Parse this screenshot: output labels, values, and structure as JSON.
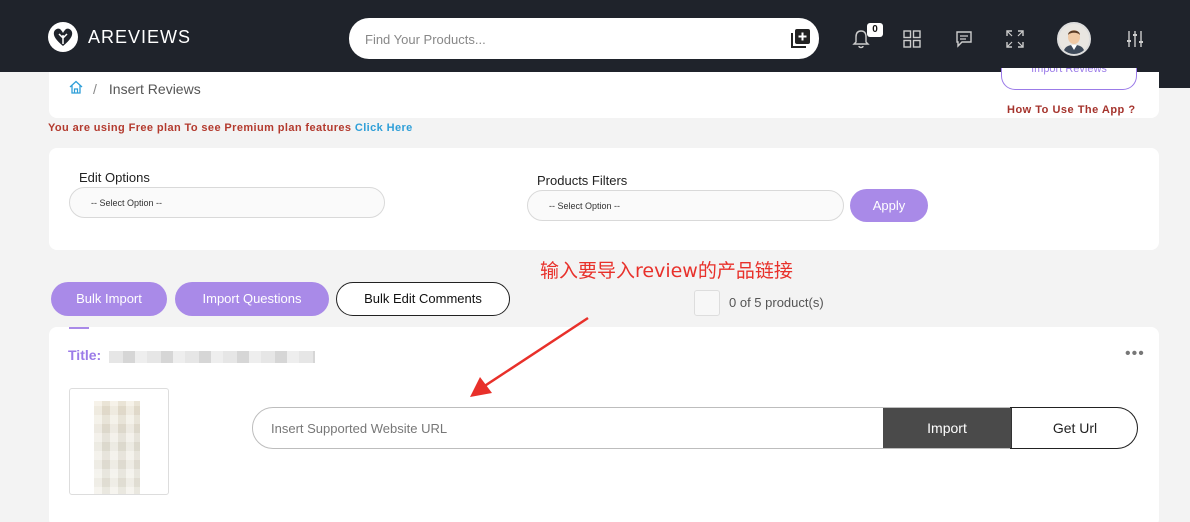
{
  "app": {
    "name": "AREVIEWS"
  },
  "search": {
    "placeholder": "Find Your Products..."
  },
  "notifications": {
    "count": "0"
  },
  "icons": {
    "logo": "heart-leaf-logo-icon",
    "search_add": "add-box-icon",
    "bell": "bell-icon",
    "apps": "grid-icon",
    "chat": "chat-icon",
    "fullscreen": "fullscreen-icon",
    "settings": "sliders-icon",
    "home": "home-icon"
  },
  "breadcrumb": {
    "separator": "/",
    "current": "Insert Reviews"
  },
  "header_actions": {
    "import_reviews": "Import Reviews",
    "how_to": "How To Use The App ?"
  },
  "plan": {
    "text": "You are using Free plan To see Premium plan features ",
    "link": "Click Here"
  },
  "options": {
    "edit_label": "Edit Options",
    "edit_value": "-- Select Option --",
    "filters_label": "Products Filters",
    "filters_value": "-- Select Option --",
    "apply": "Apply"
  },
  "annotation": {
    "text": "输入要导入review的产品链接"
  },
  "actions": {
    "bulk_import": "Bulk Import",
    "import_questions": "Import Questions",
    "bulk_edit_comments": "Bulk Edit Comments",
    "selection_count": "0 of 5 product(s)"
  },
  "product": {
    "title_label": "Title:",
    "more": "•••",
    "url_placeholder": "Insert Supported Website URL",
    "import": "Import",
    "get_url": "Get Url"
  },
  "colors": {
    "accent": "#a98ae8",
    "nav_bg": "#1f232b",
    "annotation": "#e8302a"
  }
}
